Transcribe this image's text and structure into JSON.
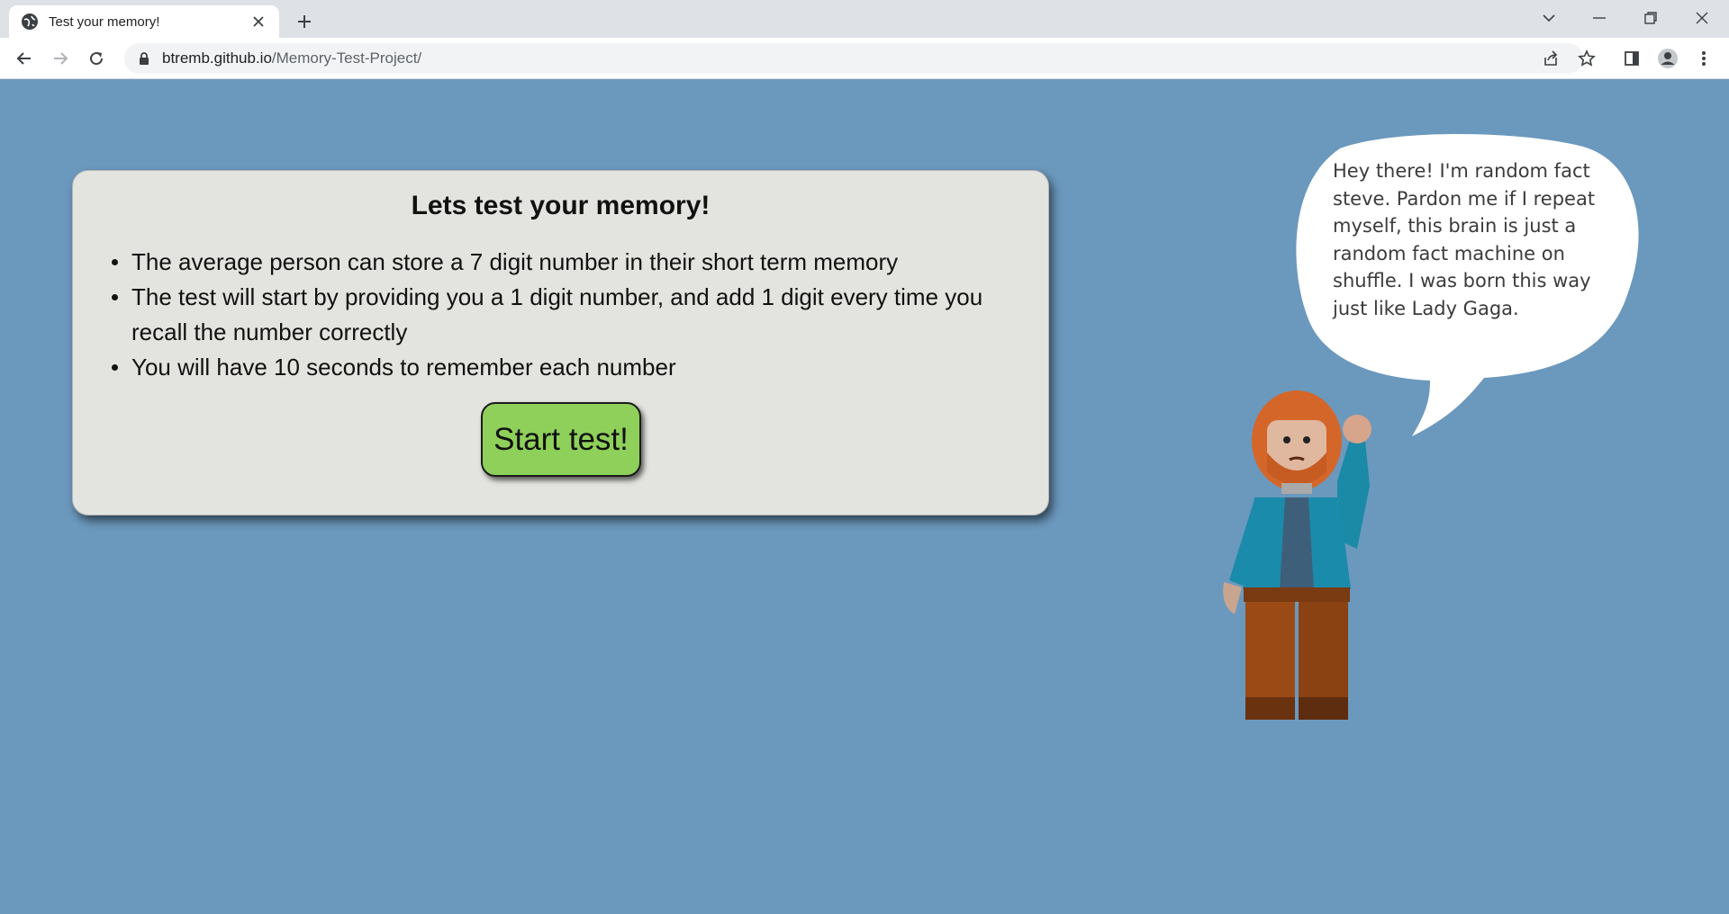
{
  "browser": {
    "tab_title": "Test your memory!",
    "url_domain": "btremb.github.io",
    "url_path": "/Memory-Test-Project/",
    "icons": [
      "globe-icon",
      "close-icon",
      "plus-icon",
      "chevron-down-icon",
      "minimize-icon",
      "restore-icon",
      "close-window-icon",
      "back-arrow-icon",
      "forward-arrow-icon",
      "reload-icon",
      "lock-icon",
      "share-icon",
      "star-icon",
      "side-panel-icon",
      "profile-icon",
      "kebab-menu-icon"
    ]
  },
  "card": {
    "title": "Lets test your memory!",
    "bullets": [
      "The average person can store a 7 digit number in their short term memory",
      "The test will start by providing you a 1 digit number, and add 1 digit every time you recall the number correctly",
      "You will have 10 seconds to remember each number"
    ],
    "start_label": "Start test!"
  },
  "steve": {
    "speech": "Hey there! I'm random fact steve. Pardon me if I repeat myself, this brain is just a random fact machine on shuffle. I was born this way just like Lady Gaga."
  },
  "colors": {
    "page_background": "#6b98bd",
    "card_background": "#e3e3df",
    "button_green": "#8fd05a"
  }
}
